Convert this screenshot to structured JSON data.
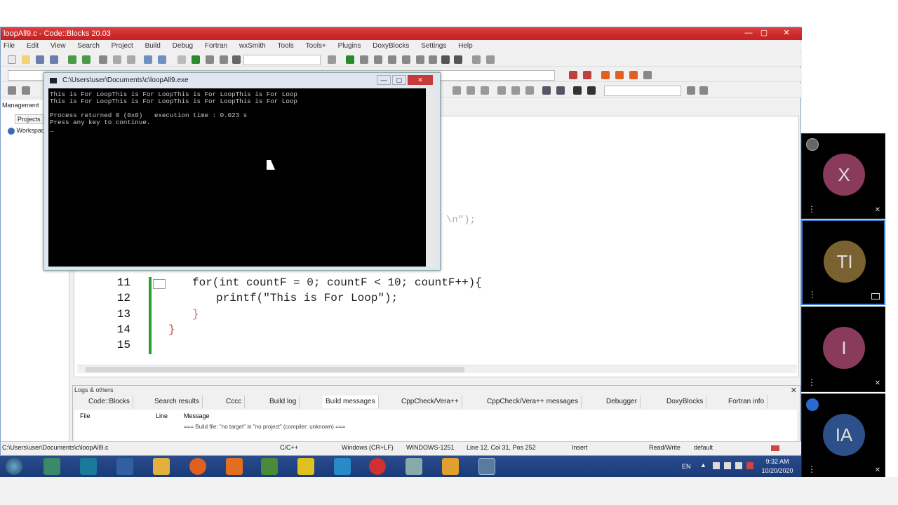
{
  "window": {
    "title": "loopAll9.c - Code::Blocks 20.03",
    "minimize": "—",
    "maximize": "▢",
    "close": "✕"
  },
  "menu": [
    "File",
    "Edit",
    "View",
    "Search",
    "Project",
    "Build",
    "Debug",
    "Fortran",
    "wxSmith",
    "Tools",
    "Tools+",
    "Plugins",
    "DoxyBlocks",
    "Settings",
    "Help"
  ],
  "management": {
    "title": "Management",
    "tab": "Projects",
    "tree_item": "Workspace"
  },
  "console": {
    "title": "C:\\Users\\user\\Documents\\c\\loopAll9.exe",
    "line1": "This is For LoopThis is For LoopThis is For LoopThis is For Loop",
    "line2": "This is For LoopThis is For LoopThis is For LoopThis is For Loop",
    "line3": "Process returned 0 (0x0)   execution time : 0.023 s",
    "line4": "Press any key to continue."
  },
  "editor": {
    "hidden_fragment": "\\n\");",
    "lines": [
      {
        "num": "11",
        "text": "for(int countF = 0; countF < 10; countF++){"
      },
      {
        "num": "12",
        "text": "printf(\"This is For Loop\");"
      },
      {
        "num": "13",
        "text": "}"
      },
      {
        "num": "14",
        "text": "}"
      },
      {
        "num": "15",
        "text": ""
      }
    ]
  },
  "logs": {
    "title": "Logs & others",
    "tabs": [
      "Code::Blocks",
      "Search results",
      "Cccc",
      "Build log",
      "Build messages",
      "CppCheck/Vera++",
      "CppCheck/Vera++ messages",
      "Debugger",
      "DoxyBlocks",
      "Fortran info"
    ],
    "columns": [
      "File",
      "Line",
      "Message"
    ],
    "message": "=== Build file: \"no target\" in \"no project\" (compiler: unknown) ==="
  },
  "status": {
    "path": "C:\\Users\\user\\Documents\\c\\loopAll9.c",
    "lang": "C/C++",
    "eol": "Windows (CR+LF)",
    "encoding": "WINDOWS-1251",
    "pos": "Line 12, Col 31, Pos 252",
    "mode": "Insert",
    "rw": "Read/Write",
    "profile": "default"
  },
  "taskbar": {
    "lang": "EN",
    "time": "9:32 AM",
    "date": "10/20/2020"
  },
  "participants": [
    {
      "initials": "X",
      "color": "#8a3a5a",
      "active": false
    },
    {
      "initials": "TI",
      "color": "#7a6230",
      "active": true
    },
    {
      "initials": "I",
      "color": "#8a3a5a",
      "active": false
    },
    {
      "initials": "IA",
      "color": "#2d4f8a",
      "active": false
    }
  ]
}
